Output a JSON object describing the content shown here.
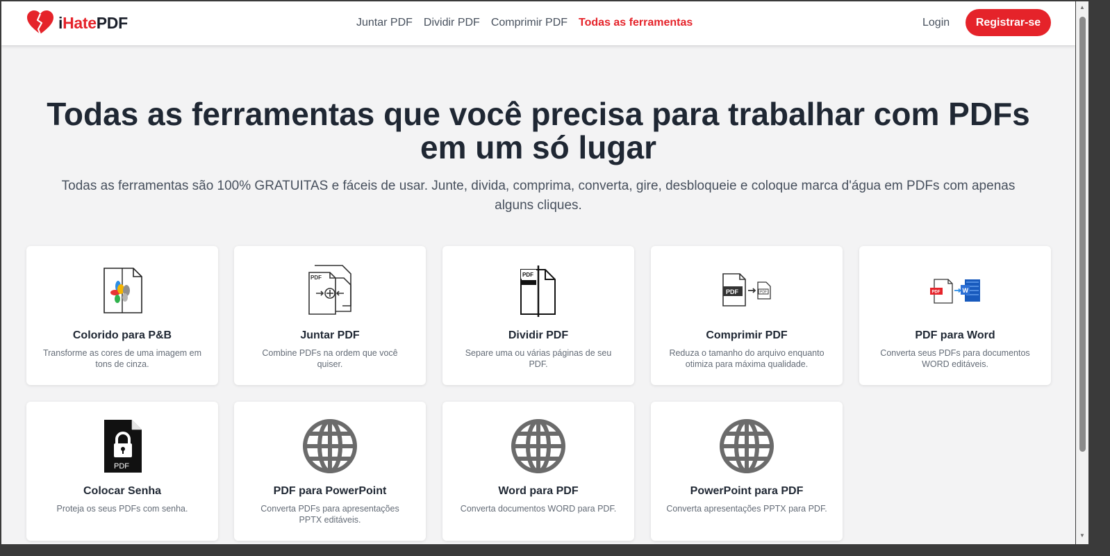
{
  "header": {
    "logo_prefix": "i",
    "logo_hate": "Hate",
    "logo_suffix": "PDF",
    "nav": [
      {
        "label": "Juntar PDF",
        "active": false
      },
      {
        "label": "Dividir PDF",
        "active": false
      },
      {
        "label": "Comprimir PDF",
        "active": false
      },
      {
        "label": "Todas as ferramentas",
        "active": true
      }
    ],
    "login_label": "Login",
    "register_label": "Registrar-se"
  },
  "hero": {
    "title": "Todas as ferramentas que você precisa para trabalhar com PDFs em um só lugar",
    "subtitle": "Todas as ferramentas são 100% GRATUITAS e fáceis de usar. Junte, divida, comprima, converta, gire, desbloqueie e coloque marca d'água em PDFs com apenas alguns cliques."
  },
  "tools": [
    {
      "icon": "grayscale-icon",
      "title": "Colorido para P&B",
      "desc": "Transforme as cores de uma imagem em tons de cinza."
    },
    {
      "icon": "merge-pdf-icon",
      "title": "Juntar PDF",
      "desc": "Combine PDFs na ordem que você quiser."
    },
    {
      "icon": "split-pdf-icon",
      "title": "Dividir PDF",
      "desc": "Separe uma ou várias páginas de seu PDF."
    },
    {
      "icon": "compress-pdf-icon",
      "title": "Comprimir PDF",
      "desc": "Reduza o tamanho do arquivo enquanto otimiza para máxima qualidade."
    },
    {
      "icon": "pdf-to-word-icon",
      "title": "PDF para Word",
      "desc": "Converta seus PDFs para documentos WORD editáveis."
    },
    {
      "icon": "lock-pdf-icon",
      "title": "Colocar Senha",
      "desc": "Proteja os seus PDFs com senha."
    },
    {
      "icon": "globe-icon",
      "title": "PDF para PowerPoint",
      "desc": "Converta PDFs para apresentações PPTX editáveis."
    },
    {
      "icon": "globe-icon",
      "title": "Word para PDF",
      "desc": "Converta documentos WORD para PDF."
    },
    {
      "icon": "globe-icon",
      "title": "PowerPoint para PDF",
      "desc": "Converta apresentações PPTX para PDF."
    }
  ],
  "icon_labels": {
    "pdf": "PDF",
    "word": "W"
  },
  "colors": {
    "brand_red": "#e5232a",
    "text_dark": "#1f2733",
    "page_bg": "#f3f3f4"
  }
}
